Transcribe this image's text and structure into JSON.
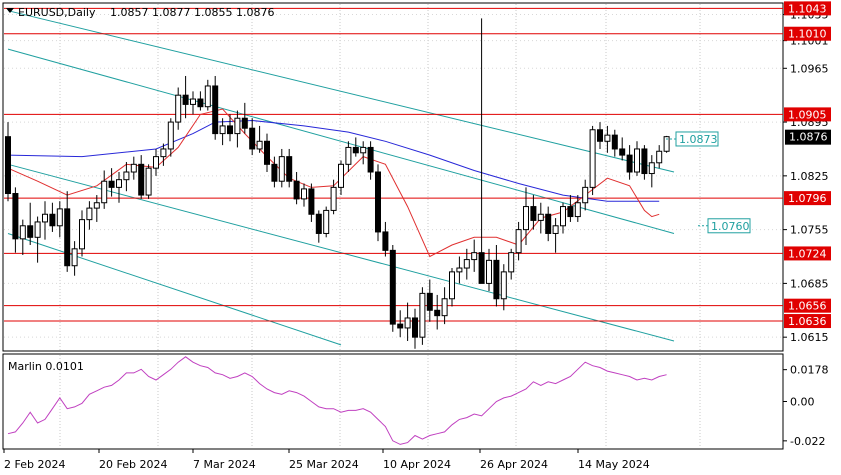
{
  "header": {
    "symbol": "EURUSD,Daily",
    "ohlc": "1.0857 1.0877 1.0855 1.0876"
  },
  "price_axis": {
    "ticks": [
      "1.1035",
      "1.1001",
      "1.0965",
      "1.0895",
      "1.0825",
      "1.0755",
      "1.0685",
      "1.0615"
    ]
  },
  "levels": [
    {
      "label": "1.1043",
      "value": 1.1043
    },
    {
      "label": "1.1010",
      "value": 1.101
    },
    {
      "label": "1.0905",
      "value": 1.0905
    },
    {
      "label": "1.0796",
      "value": 1.0796
    },
    {
      "label": "1.0724",
      "value": 1.0724
    },
    {
      "label": "1.0656",
      "value": 1.0656
    },
    {
      "label": "1.0636",
      "value": 1.0636
    }
  ],
  "current_price": {
    "label": "1.0876",
    "value": 1.0876
  },
  "channel_labels": [
    {
      "label": "1.0873",
      "value": 1.0873
    },
    {
      "label": "1.0760",
      "value": 1.076
    }
  ],
  "indicator": {
    "title": "Marlin 0.0101",
    "ticks": [
      "0.0178",
      "0.00",
      "-0.022"
    ]
  },
  "time_axis": {
    "labels": [
      "2 Feb 2024",
      "20 Feb 2024",
      "7 Mar 2024",
      "25 Mar 2024",
      "10 Apr 2024",
      "26 Apr 2024",
      "14 May 2024"
    ]
  },
  "colors": {
    "up_candle": "#000000",
    "down_candle": "#000000",
    "level_line": "#e00000",
    "channel_line": "#20a0a0",
    "ma_blue": "#2828d8",
    "ma_red": "#e03030",
    "oscillator": "#c040c0",
    "current_price_bg": "#000000"
  },
  "chart_data": {
    "type": "candlestick",
    "ohlc": [
      [
        1.0876,
        1.0895,
        1.0792,
        1.0802
      ],
      [
        1.0802,
        1.081,
        1.0725,
        1.0743
      ],
      [
        1.0743,
        1.0768,
        1.0722,
        1.076
      ],
      [
        1.076,
        1.079,
        1.0735,
        1.0745
      ],
      [
        1.0745,
        1.0772,
        1.0712,
        1.0765
      ],
      [
        1.0765,
        1.0792,
        1.0742,
        1.0775
      ],
      [
        1.0775,
        1.079,
        1.0752,
        1.076
      ],
      [
        1.076,
        1.0792,
        1.0745,
        1.0782
      ],
      [
        1.0782,
        1.0805,
        1.07,
        1.0708
      ],
      [
        1.0708,
        1.074,
        1.0695,
        1.073
      ],
      [
        1.073,
        1.078,
        1.072,
        1.0768
      ],
      [
        1.0768,
        1.0792,
        1.0755,
        1.0783
      ],
      [
        1.0783,
        1.08,
        1.0765,
        1.079
      ],
      [
        1.079,
        1.0832,
        1.0782,
        1.0818
      ],
      [
        1.0818,
        1.0835,
        1.0798,
        1.081
      ],
      [
        1.081,
        1.083,
        1.079,
        1.082
      ],
      [
        1.082,
        1.0843,
        1.0805,
        1.083
      ],
      [
        1.083,
        1.085,
        1.082,
        1.084
      ],
      [
        1.084,
        1.0852,
        1.0795,
        1.08
      ],
      [
        1.08,
        1.084,
        1.0795,
        1.0835
      ],
      [
        1.0835,
        1.086,
        1.0825,
        1.085
      ],
      [
        1.085,
        1.0867,
        1.0838,
        1.086
      ],
      [
        1.086,
        1.09,
        1.085,
        1.0895
      ],
      [
        1.0895,
        1.094,
        1.0885,
        1.093
      ],
      [
        1.093,
        1.0955,
        1.09,
        1.0918
      ],
      [
        1.0918,
        1.0935,
        1.0905,
        1.0925
      ],
      [
        1.0925,
        1.0935,
        1.091,
        1.0915
      ],
      [
        1.0915,
        1.095,
        1.091,
        1.0942
      ],
      [
        1.0942,
        1.0955,
        1.0872,
        1.088
      ],
      [
        1.088,
        1.09,
        1.0865,
        1.089
      ],
      [
        1.089,
        1.0905,
        1.087,
        1.088
      ],
      [
        1.088,
        1.091,
        1.0862,
        1.09
      ],
      [
        1.09,
        1.092,
        1.088,
        1.0887
      ],
      [
        1.0887,
        1.09,
        1.0852,
        1.086
      ],
      [
        1.086,
        1.089,
        1.0855,
        1.087
      ],
      [
        1.087,
        1.088,
        1.083,
        1.084
      ],
      [
        1.084,
        1.085,
        1.081,
        1.0818
      ],
      [
        1.0818,
        1.086,
        1.081,
        1.085
      ],
      [
        1.085,
        1.086,
        1.081,
        1.0818
      ],
      [
        1.0818,
        1.083,
        1.0788,
        1.0795
      ],
      [
        1.0795,
        1.0815,
        1.0785,
        1.0808
      ],
      [
        1.0808,
        1.0815,
        1.0765,
        1.0775
      ],
      [
        1.0775,
        1.078,
        1.0738,
        1.075
      ],
      [
        1.075,
        1.0785,
        1.0745,
        1.078
      ],
      [
        1.078,
        1.082,
        1.0775,
        1.081
      ],
      [
        1.081,
        1.0845,
        1.08,
        1.084
      ],
      [
        1.084,
        1.087,
        1.083,
        1.0862
      ],
      [
        1.0862,
        1.0875,
        1.085,
        1.0855
      ],
      [
        1.0855,
        1.087,
        1.084,
        1.0862
      ],
      [
        1.0862,
        1.087,
        1.082,
        1.083
      ],
      [
        1.083,
        1.084,
        1.074,
        1.0752
      ],
      [
        1.0752,
        1.0765,
        1.072,
        1.0728
      ],
      [
        1.0728,
        1.0735,
        1.0622,
        1.0632
      ],
      [
        1.0632,
        1.065,
        1.0615,
        1.0627
      ],
      [
        1.0627,
        1.066,
        1.061,
        1.064
      ],
      [
        1.064,
        1.0652,
        1.06,
        1.0615
      ],
      [
        1.0615,
        1.068,
        1.0605,
        1.0672
      ],
      [
        1.0672,
        1.069,
        1.0635,
        1.065
      ],
      [
        1.065,
        1.067,
        1.0625,
        1.0643
      ],
      [
        1.0643,
        1.068,
        1.0632,
        1.0665
      ],
      [
        1.0665,
        1.0705,
        1.0655,
        1.07
      ],
      [
        1.07,
        1.072,
        1.0685,
        1.0705
      ],
      [
        1.0705,
        1.073,
        1.069,
        1.0716
      ],
      [
        1.0716,
        1.0742,
        1.07,
        1.0725
      ],
      [
        1.0725,
        1.103,
        1.07,
        1.0685
      ],
      [
        1.0685,
        1.073,
        1.0675,
        1.0715
      ],
      [
        1.0715,
        1.0735,
        1.0655,
        1.0665
      ],
      [
        1.0665,
        1.071,
        1.065,
        1.07
      ],
      [
        1.07,
        1.073,
        1.069,
        1.0725
      ],
      [
        1.0725,
        1.0765,
        1.0715,
        1.0755
      ],
      [
        1.0755,
        1.081,
        1.0735,
        1.0785
      ],
      [
        1.0785,
        1.08,
        1.0755,
        1.0767
      ],
      [
        1.0767,
        1.079,
        1.075,
        1.0775
      ],
      [
        1.0775,
        1.0785,
        1.074,
        1.075
      ],
      [
        1.075,
        1.077,
        1.0725,
        1.076
      ],
      [
        1.076,
        1.079,
        1.075,
        1.0785
      ],
      [
        1.0785,
        1.08,
        1.0765,
        1.0772
      ],
      [
        1.0772,
        1.08,
        1.0765,
        1.079
      ],
      [
        1.079,
        1.082,
        1.078,
        1.081
      ],
      [
        1.081,
        1.089,
        1.08,
        1.0885
      ],
      [
        1.0885,
        1.0895,
        1.086,
        1.087
      ],
      [
        1.087,
        1.089,
        1.0855,
        1.0878
      ],
      [
        1.0878,
        1.0885,
        1.085,
        1.086
      ],
      [
        1.086,
        1.0875,
        1.0845,
        1.0852
      ],
      [
        1.0852,
        1.0865,
        1.082,
        1.083
      ],
      [
        1.083,
        1.087,
        1.0825,
        1.086
      ],
      [
        1.086,
        1.0865,
        1.082,
        1.0828
      ],
      [
        1.0828,
        1.0852,
        1.081,
        1.0842
      ],
      [
        1.0842,
        1.0865,
        1.0835,
        1.0857
      ],
      [
        1.0857,
        1.0877,
        1.0855,
        1.0876
      ]
    ],
    "levels": [
      1.1043,
      1.101,
      1.0905,
      1.0796,
      1.0724,
      1.0656,
      1.0636
    ],
    "ma_blue": [
      [
        0,
        1.0852
      ],
      [
        10,
        1.085
      ],
      [
        20,
        1.086
      ],
      [
        25,
        1.088
      ],
      [
        28,
        1.0895
      ],
      [
        33,
        1.0897
      ],
      [
        40,
        1.089
      ],
      [
        46,
        1.0882
      ],
      [
        51,
        1.087
      ],
      [
        57,
        1.0852
      ],
      [
        63,
        1.0832
      ],
      [
        69,
        1.0815
      ],
      [
        75,
        1.08
      ],
      [
        81,
        1.0792
      ],
      [
        88,
        1.0792
      ]
    ],
    "ma_red": [
      [
        0,
        1.0835
      ],
      [
        4,
        1.0818
      ],
      [
        8,
        1.08
      ],
      [
        12,
        1.0812
      ],
      [
        16,
        1.084
      ],
      [
        20,
        1.0836
      ],
      [
        23,
        1.0862
      ],
      [
        26,
        1.0905
      ],
      [
        29,
        1.0912
      ],
      [
        32,
        1.088
      ],
      [
        35,
        1.085
      ],
      [
        38,
        1.0822
      ],
      [
        41,
        1.081
      ],
      [
        44,
        1.0812
      ],
      [
        48,
        1.085
      ],
      [
        51,
        1.084
      ],
      [
        54,
        1.0785
      ],
      [
        57,
        1.072
      ],
      [
        60,
        1.0735
      ],
      [
        63,
        1.0745
      ],
      [
        66,
        1.0745
      ],
      [
        69,
        1.0735
      ],
      [
        72,
        1.077
      ],
      [
        75,
        1.0778
      ],
      [
        78,
        1.08
      ],
      [
        81,
        1.0822
      ],
      [
        84,
        1.0812
      ],
      [
        86,
        1.078
      ],
      [
        87,
        1.0772
      ],
      [
        88,
        1.0775
      ]
    ],
    "channel_lines": [
      [
        [
          0,
          1.104
        ],
        [
          90,
          1.083
        ]
      ],
      [
        [
          0,
          1.099
        ],
        [
          90,
          1.075
        ]
      ],
      [
        [
          0,
          1.084
        ],
        [
          90,
          1.061
        ]
      ],
      [
        [
          0,
          1.075
        ],
        [
          45,
          1.0605
        ]
      ]
    ],
    "oscillator": {
      "name": "Marlin",
      "values": [
        -0.018,
        -0.017,
        -0.012,
        -0.006,
        -0.012,
        -0.01,
        -0.004,
        0.002,
        -0.004,
        -0.003,
        -0.001,
        0.004,
        0.006,
        0.008,
        0.009,
        0.012,
        0.016,
        0.016,
        0.018,
        0.014,
        0.012,
        0.015,
        0.018,
        0.022,
        0.025,
        0.022,
        0.02,
        0.019,
        0.016,
        0.015,
        0.013,
        0.014,
        0.016,
        0.014,
        0.01,
        0.007,
        0.005,
        0.004,
        0.006,
        0.005,
        0.003,
        0.0,
        -0.003,
        -0.004,
        -0.004,
        -0.006,
        -0.005,
        -0.005,
        -0.004,
        -0.006,
        -0.01,
        -0.014,
        -0.022,
        -0.024,
        -0.023,
        -0.019,
        -0.021,
        -0.019,
        -0.018,
        -0.017,
        -0.013,
        -0.01,
        -0.009,
        -0.007,
        -0.008,
        -0.004,
        0.0,
        0.002,
        0.003,
        0.005,
        0.007,
        0.011,
        0.009,
        0.011,
        0.01,
        0.012,
        0.014,
        0.018,
        0.022,
        0.02,
        0.019,
        0.017,
        0.016,
        0.015,
        0.014,
        0.012,
        0.013,
        0.012,
        0.014,
        0.015
      ],
      "ylim": [
        -0.026,
        0.026
      ]
    },
    "ylim": [
      1.0597,
      1.105
    ]
  }
}
